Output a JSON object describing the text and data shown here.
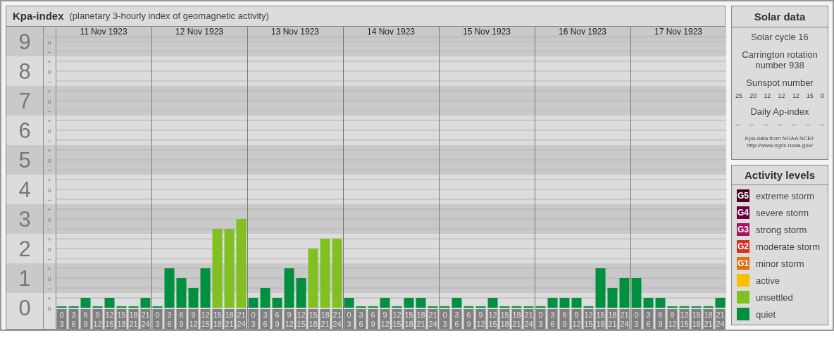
{
  "title": {
    "name": "Kpa-index",
    "subtitle": "(planetary 3-hourly index of geomagnetic activity)"
  },
  "chart": {
    "minor_marks": [
      [
        "o",
        "−"
      ],
      [
        "+",
        "o",
        "−"
      ],
      [
        "+",
        "o",
        "−"
      ],
      [
        "+",
        "o",
        "−"
      ],
      [
        "+",
        "o",
        "−"
      ],
      [
        "+",
        "o",
        "−"
      ],
      [
        "+",
        "o",
        "−"
      ],
      [
        "+",
        "o",
        "−"
      ],
      [
        "+",
        "o",
        "−"
      ],
      [
        "+",
        "o"
      ]
    ],
    "chart_data": {
      "type": "bar",
      "ylim": [
        0,
        9
      ],
      "grid": true,
      "yticks": [
        {
          "value": 9,
          "label": "9"
        },
        {
          "value": 8,
          "label": "8"
        },
        {
          "value": 7,
          "label": "7"
        },
        {
          "value": 6,
          "label": "6"
        },
        {
          "value": 5,
          "label": "5"
        },
        {
          "value": 4,
          "label": "4"
        },
        {
          "value": 3,
          "label": "3"
        },
        {
          "value": 2,
          "label": "2"
        },
        {
          "value": 1,
          "label": "1"
        },
        {
          "value": 0,
          "label": "0"
        }
      ],
      "values": [
        0,
        0,
        0.33,
        0,
        0.33,
        0,
        0,
        0.33,
        0,
        1.33,
        1,
        0.67,
        1.33,
        2.67,
        2.67,
        3,
        0.33,
        0.67,
        0.33,
        1.33,
        1,
        2,
        2.33,
        2.33,
        0.33,
        0,
        0,
        0.33,
        0,
        0.33,
        0.33,
        0,
        0,
        0.33,
        0,
        0,
        0.33,
        0,
        0,
        0,
        0,
        0.33,
        0.33,
        0.33,
        0,
        1.33,
        0.67,
        1,
        1,
        0.33,
        0.33,
        0,
        0,
        0,
        0,
        0.33
      ]
    },
    "days": [
      {
        "date": "11 Nov 1923",
        "slots": [
          {
            "from": "0",
            "to": "3"
          },
          {
            "from": "3",
            "to": "6"
          },
          {
            "from": "6",
            "to": "9"
          },
          {
            "from": "9",
            "to": "12"
          },
          {
            "from": "12",
            "to": "15"
          },
          {
            "from": "15",
            "to": "18"
          },
          {
            "from": "18",
            "to": "21"
          },
          {
            "from": "21",
            "to": "24"
          }
        ]
      },
      {
        "date": "12 Nov 1923",
        "slots": [
          {
            "from": "0",
            "to": "3"
          },
          {
            "from": "3",
            "to": "6"
          },
          {
            "from": "6",
            "to": "9"
          },
          {
            "from": "9",
            "to": "12"
          },
          {
            "from": "12",
            "to": "15"
          },
          {
            "from": "15",
            "to": "18"
          },
          {
            "from": "18",
            "to": "21"
          },
          {
            "from": "21",
            "to": "24"
          }
        ]
      },
      {
        "date": "13 Nov 1923",
        "slots": [
          {
            "from": "0",
            "to": "3"
          },
          {
            "from": "3",
            "to": "6"
          },
          {
            "from": "6",
            "to": "9"
          },
          {
            "from": "9",
            "to": "12"
          },
          {
            "from": "12",
            "to": "15"
          },
          {
            "from": "15",
            "to": "18"
          },
          {
            "from": "18",
            "to": "21"
          },
          {
            "from": "21",
            "to": "24"
          }
        ]
      },
      {
        "date": "14 Nov 1923",
        "slots": [
          {
            "from": "0",
            "to": "3"
          },
          {
            "from": "3",
            "to": "6"
          },
          {
            "from": "6",
            "to": "9"
          },
          {
            "from": "9",
            "to": "12"
          },
          {
            "from": "12",
            "to": "15"
          },
          {
            "from": "15",
            "to": "18"
          },
          {
            "from": "18",
            "to": "21"
          },
          {
            "from": "21",
            "to": "24"
          }
        ]
      },
      {
        "date": "15 Nov 1923",
        "slots": [
          {
            "from": "0",
            "to": "3"
          },
          {
            "from": "3",
            "to": "6"
          },
          {
            "from": "6",
            "to": "9"
          },
          {
            "from": "9",
            "to": "12"
          },
          {
            "from": "12",
            "to": "15"
          },
          {
            "from": "15",
            "to": "18"
          },
          {
            "from": "18",
            "to": "21"
          },
          {
            "from": "21",
            "to": "24"
          }
        ]
      },
      {
        "date": "16 Nov 1923",
        "slots": [
          {
            "from": "0",
            "to": "3"
          },
          {
            "from": "3",
            "to": "6"
          },
          {
            "from": "6",
            "to": "9"
          },
          {
            "from": "9",
            "to": "12"
          },
          {
            "from": "12",
            "to": "15"
          },
          {
            "from": "15",
            "to": "18"
          },
          {
            "from": "18",
            "to": "21"
          },
          {
            "from": "21",
            "to": "24"
          }
        ]
      },
      {
        "date": "17 Nov 1923",
        "slots": [
          {
            "from": "0",
            "to": "3"
          },
          {
            "from": "3",
            "to": "6"
          },
          {
            "from": "6",
            "to": "9"
          },
          {
            "from": "9",
            "to": "12"
          },
          {
            "from": "12",
            "to": "15"
          },
          {
            "from": "15",
            "to": "18"
          },
          {
            "from": "18",
            "to": "21"
          },
          {
            "from": "21",
            "to": "24"
          }
        ]
      }
    ]
  },
  "solar_data": {
    "title": "Solar data",
    "solar_cycle": "Solar cycle 16",
    "carrington": "Carrington rotation number 938",
    "sunspot_title": "Sunspot number",
    "sunspots": [
      "25",
      "20",
      "12",
      "12",
      "12",
      "15",
      "0"
    ],
    "ap_title": "Daily Ap-index",
    "ap_values": [
      "--",
      "--",
      "--",
      "--",
      "--",
      "--",
      "--"
    ],
    "source": "Kpa-data from NOAA NCEI:",
    "source_url": "http://www.ngdc.noaa.gov/"
  },
  "activity_levels": {
    "title": "Activity levels",
    "items": [
      {
        "badge": "G5",
        "label": "extreme storm",
        "color": "#4a0020"
      },
      {
        "badge": "G4",
        "label": "severe storm",
        "color": "#6a0040"
      },
      {
        "badge": "G3",
        "label": "strong storm",
        "color": "#a81060"
      },
      {
        "badge": "G2",
        "label": "moderate storm",
        "color": "#d83020"
      },
      {
        "badge": "G1",
        "label": "minor storm",
        "color": "#e07010"
      },
      {
        "label": "active",
        "color": "#f8c000"
      },
      {
        "label": "unsettled",
        "color": "#80c020"
      },
      {
        "label": "quiet",
        "color": "#009040"
      }
    ]
  }
}
